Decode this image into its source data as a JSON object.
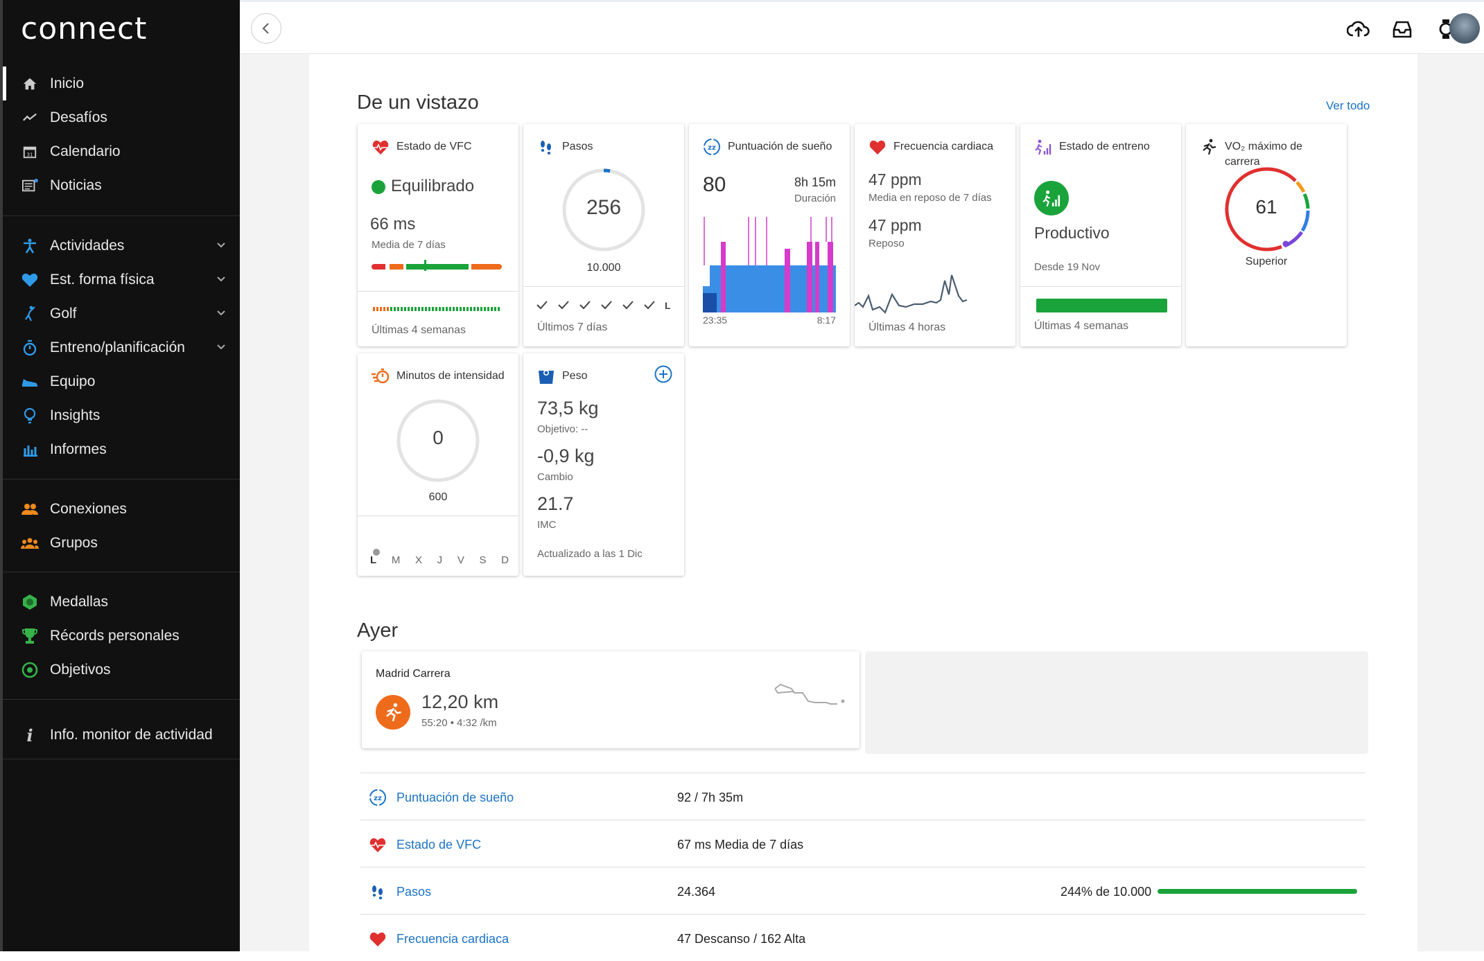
{
  "app": {
    "logo": "connect"
  },
  "nav": {
    "group1": [
      {
        "label": "Inicio",
        "icon": "home-icon"
      },
      {
        "label": "Desafíos",
        "icon": "challenges-icon"
      },
      {
        "label": "Calendario",
        "icon": "calendar-icon"
      },
      {
        "label": "Noticias",
        "icon": "news-icon"
      }
    ],
    "group2": [
      {
        "label": "Actividades",
        "icon": "activity-icon"
      },
      {
        "label": "Est. forma física",
        "icon": "heart-icon"
      },
      {
        "label": "Golf",
        "icon": "golf-icon"
      },
      {
        "label": "Entreno/planificación",
        "icon": "stopwatch-icon"
      },
      {
        "label": "Equipo",
        "icon": "shoe-icon"
      },
      {
        "label": "Insights",
        "icon": "lightbulb-icon"
      },
      {
        "label": "Informes",
        "icon": "bar-chart-icon"
      }
    ],
    "group3": [
      {
        "label": "Conexiones",
        "icon": "connections-icon"
      },
      {
        "label": "Grupos",
        "icon": "groups-icon"
      }
    ],
    "group4": [
      {
        "label": "Medallas",
        "icon": "badge-icon"
      },
      {
        "label": "Récords personales",
        "icon": "trophy-icon"
      },
      {
        "label": "Objetivos",
        "icon": "target-icon"
      }
    ],
    "group5": [
      {
        "label": "Info. monitor de actividad",
        "icon": "info-icon"
      }
    ]
  },
  "glance": {
    "title": "De un vistazo",
    "view_all": "Ver todo",
    "vfc": {
      "title": "Estado de VFC",
      "status": "Equilibrado",
      "value": "66 ms",
      "sub": "Media de 7 días",
      "footer": "Últimas 4 semanas"
    },
    "steps": {
      "title": "Pasos",
      "value": "256",
      "goal": "10.000",
      "progress": 0.0256,
      "footer": "Últimos 7 días",
      "last_day": "L"
    },
    "sleep": {
      "title": "Puntuación de sueño",
      "score": "80",
      "duration": "8h 15m",
      "duration_label": "Duración",
      "start": "23:35",
      "end": "8:17"
    },
    "hr": {
      "title": "Frecuencia cardiaca",
      "rest7": "47 ppm",
      "rest7_label": "Media en reposo de 7 días",
      "rest": "47 ppm",
      "rest_label": "Reposo",
      "footer": "Últimas 4 horas"
    },
    "training": {
      "title": "Estado de entreno",
      "status": "Productivo",
      "since": "Desde 19 Nov",
      "footer": "Últimas 4 semanas"
    },
    "vo2": {
      "title": "VO₂ máximo de carrera",
      "value": "61",
      "label": "Superior"
    },
    "intensity": {
      "title": "Minutos de intensidad",
      "value": "0",
      "goal": "600",
      "days": [
        "L",
        "M",
        "X",
        "J",
        "V",
        "S",
        "D"
      ]
    },
    "weight": {
      "title": "Peso",
      "value": "73,5 kg",
      "goal": "Objetivo: --",
      "change": "-0,9 kg",
      "change_label": "Cambio",
      "bmi": "21.7",
      "bmi_label": "IMC",
      "updated": "Actualizado a las 1 Dic"
    }
  },
  "yesterday": {
    "title": "Ayer",
    "activity": {
      "name": "Madrid Carrera",
      "distance": "12,20 km",
      "details": "55:20 • 4:32 /km"
    },
    "rows": [
      {
        "name": "Puntuación de sueño",
        "value": "92 / 7h 35m",
        "icon": "sleep-icon"
      },
      {
        "name": "Estado de VFC",
        "value": "67 ms Media de 7 días",
        "icon": "hrv-icon"
      },
      {
        "name": "Pasos",
        "value": "24.364",
        "goal_text": "244% de 10.000",
        "progress": 1.0,
        "icon": "steps-icon"
      },
      {
        "name": "Frecuencia cardiaca",
        "value": "47 Descanso / 162 Alta",
        "icon": "heart-icon"
      }
    ]
  },
  "colors": {
    "accent": "#1a73c7",
    "green": "#1aa33a",
    "red": "#e0302f",
    "orange": "#ee6b1c"
  }
}
